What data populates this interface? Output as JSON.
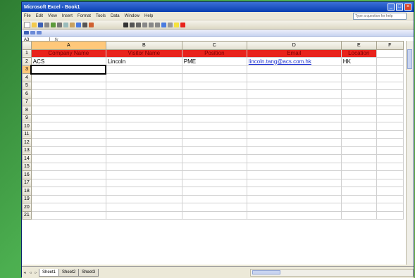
{
  "window": {
    "title": "Microsoft Excel - Book1"
  },
  "menu": {
    "items": [
      "File",
      "Edit",
      "View",
      "Insert",
      "Format",
      "Tools",
      "Data",
      "Window",
      "Help"
    ],
    "help_placeholder": "Type a question for help"
  },
  "formula_bar": {
    "cell_ref": "A3",
    "fx": "fx",
    "value": ""
  },
  "columns": [
    "A",
    "B",
    "C",
    "D",
    "E",
    "F"
  ],
  "rows": [
    "1",
    "2",
    "3",
    "4",
    "5",
    "6",
    "7",
    "8",
    "9",
    "10",
    "11",
    "12",
    "13",
    "14",
    "15",
    "16",
    "17",
    "18",
    "19",
    "20",
    "21"
  ],
  "sheet": {
    "headers": [
      "Company Name",
      "Visitor Name",
      "Position",
      "Email",
      "Location"
    ],
    "row2": [
      "ACS",
      "Lincoln",
      "PME",
      "lincoln.tang@acs.com.hk",
      "HK"
    ]
  },
  "tabs": [
    "Sheet1",
    "Sheet2",
    "Sheet3"
  ],
  "colors": {
    "header_fill": "#e8231c",
    "header_text": "#7a0000",
    "link": "#1a2fd1"
  }
}
